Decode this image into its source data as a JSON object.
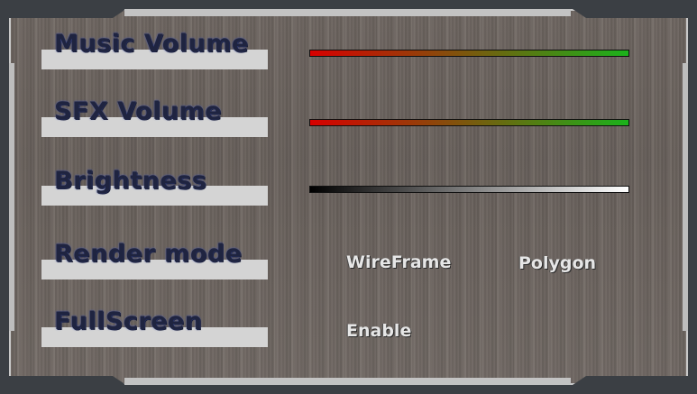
{
  "settings": {
    "music_volume": {
      "label": "Music Volume",
      "value": 1.0,
      "gradient": [
        "#d80000",
        "#1bb21b"
      ]
    },
    "sfx_volume": {
      "label": "SFX Volume",
      "value": 1.0,
      "gradient": [
        "#d80000",
        "#1bb21b"
      ]
    },
    "brightness": {
      "label": "Brightness",
      "value": 1.0,
      "gradient": [
        "#000000",
        "#ffffff"
      ]
    },
    "render_mode": {
      "label": "Render mode",
      "options": [
        "WireFrame",
        "Polygon"
      ]
    },
    "fullscreen": {
      "label": "FullScreen",
      "options": [
        "Enable"
      ]
    }
  },
  "colors": {
    "label_text": "#1f2440",
    "label_glow": "#4656a8",
    "plate": "#d4d4d4",
    "panel": "#6f6762",
    "option_text": "#e6e6e6"
  }
}
